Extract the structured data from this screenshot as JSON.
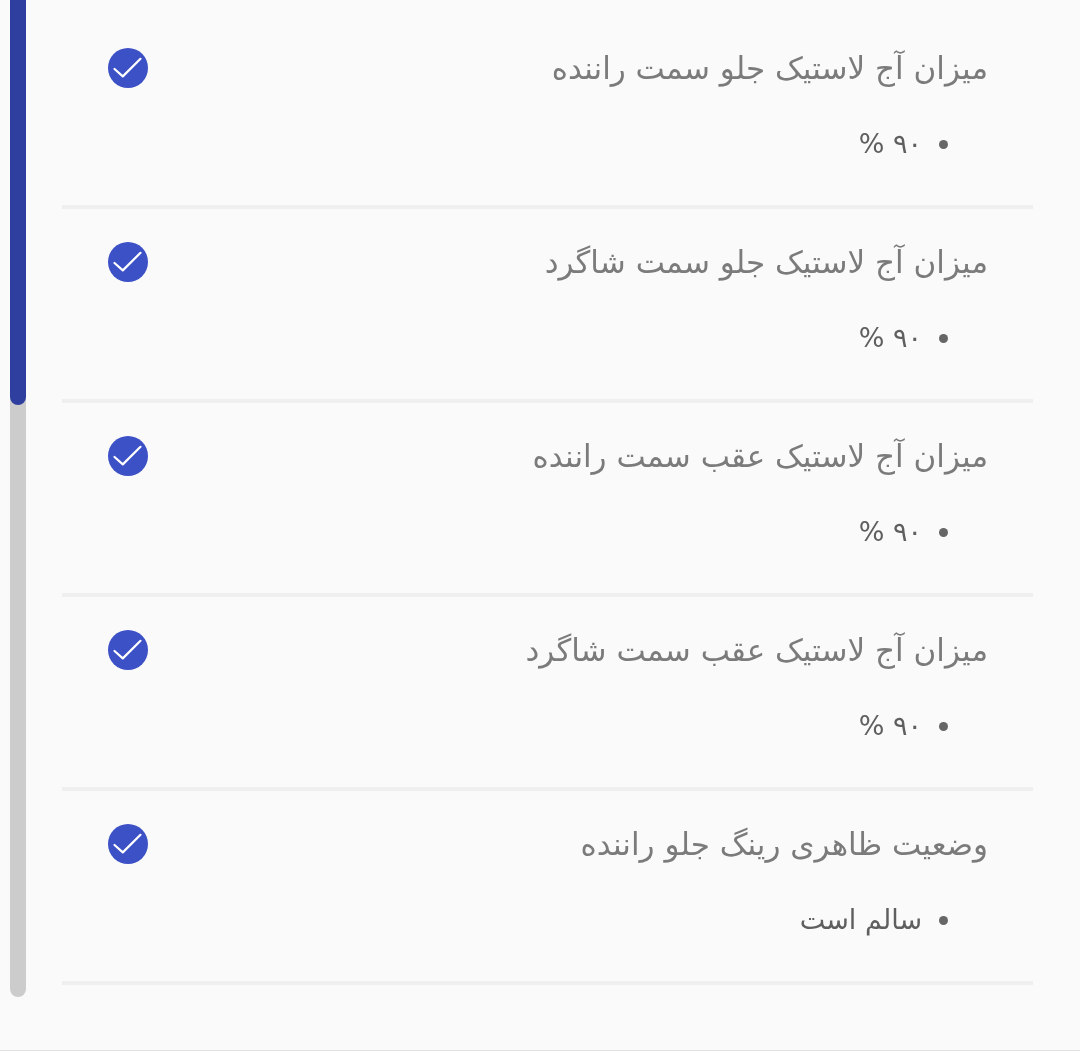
{
  "items": [
    {
      "title": "میزان آج لاستیک جلو سمت راننده",
      "value": "۹۰ %",
      "checked": true
    },
    {
      "title": "میزان آج لاستیک جلو سمت شاگرد",
      "value": "۹۰ %",
      "checked": true
    },
    {
      "title": "میزان آج لاستیک عقب سمت راننده",
      "value": "۹۰ %",
      "checked": true
    },
    {
      "title": "میزان آج لاستیک عقب سمت شاگرد",
      "value": "۹۰ %",
      "checked": true
    },
    {
      "title": "وضعیت ظاهری رینگ جلو راننده",
      "value": "سالم است",
      "checked": true
    }
  ]
}
